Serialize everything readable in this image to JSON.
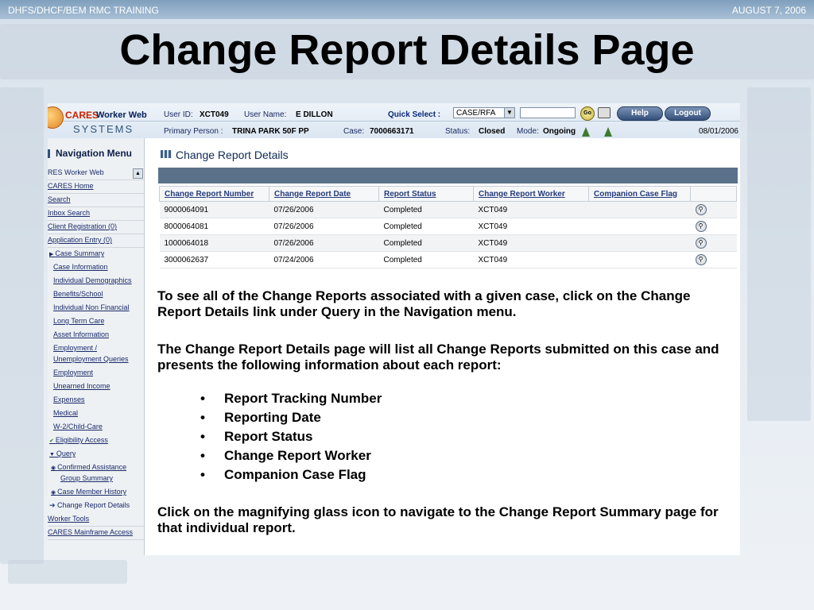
{
  "slide": {
    "header_left": "DHFS/DHCF/BEM  RMC TRAINING",
    "header_right": "AUGUST 7, 2006",
    "title": "Change Report Details Page"
  },
  "app": {
    "brand_cares": "CARES",
    "brand_ww": "Worker Web",
    "brand_systems": "SYSTEMS",
    "user_id_label": "User ID:",
    "user_id": "XCT049",
    "user_name_label": "User Name:",
    "user_name": "E DILLON",
    "quick_select_label": "Quick Select :",
    "quick_select_value": "CASE/RFA",
    "go_label": "Go",
    "help_label": "Help",
    "logout_label": "Logout",
    "primary_person_label": "Primary Person :",
    "primary_person": "TRINA PARK 50F PP",
    "case_label": "Case:",
    "case_number": "7000663171",
    "status_label": "Status:",
    "status": "Closed",
    "mode_label": "Mode:",
    "mode": "Ongoing",
    "date": "08/01/2006"
  },
  "nav": {
    "title": "Navigation Menu",
    "items": [
      "RES Worker Web",
      "CARES Home",
      "Search",
      "Inbox Search",
      "Client Registration (0)",
      "Application Entry (0)",
      "Case Summary",
      "Case Information",
      "Individual Demographics",
      "Benefits/School",
      "Individual Non Financial",
      "Long Term Care",
      "Asset Information",
      "Employment /",
      "Unemployment Queries",
      "Employment",
      "Unearned Income",
      "Expenses",
      "Medical",
      "W-2/Child-Care",
      "Eligibility Access",
      "Query",
      "Confirmed Assistance",
      "Group Summary",
      "Case Member History",
      "Change Report Details",
      "Worker Tools",
      "CARES Mainframe Access"
    ]
  },
  "content": {
    "title": "Change Report Details",
    "columns": [
      "Change Report Number",
      "Change Report Date",
      "Report Status",
      "Change Report Worker",
      "Companion Case Flag"
    ],
    "rows": [
      [
        "9000064091",
        "07/26/2006",
        "Completed",
        "XCT049",
        ""
      ],
      [
        "8000064081",
        "07/26/2006",
        "Completed",
        "XCT049",
        ""
      ],
      [
        "1000064018",
        "07/26/2006",
        "Completed",
        "XCT049",
        ""
      ],
      [
        "3000062637",
        "07/24/2006",
        "Completed",
        "XCT049",
        ""
      ]
    ],
    "row_icon": "magnifying-glass-icon"
  },
  "text": {
    "para1": "To see all of the  Change Reports associated with a given case, click on the Change Report Details link under Query in the Navigation menu.",
    "para2": "The Change Report Details page will list all Change Reports submitted on this case and presents the following information about each report:",
    "bullets": [
      "Report Tracking Number",
      "Reporting Date",
      "Report Status",
      "Change Report Worker",
      "Companion Case Flag"
    ],
    "para3": "Click on the magnifying glass icon to navigate to the Change Report Summary page for that individual report."
  }
}
